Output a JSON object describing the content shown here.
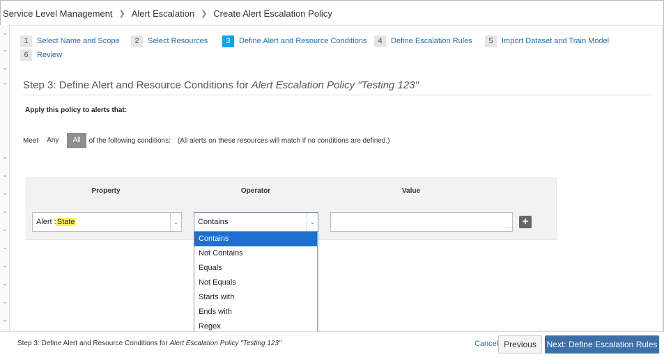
{
  "breadcrumb": [
    "Service Level Management",
    "Alert Escalation",
    "Create Alert Escalation Policy"
  ],
  "wizard": {
    "steps": [
      {
        "num": "1",
        "label": "Select Name and Scope"
      },
      {
        "num": "2",
        "label": "Select Resources"
      },
      {
        "num": "3",
        "label": "Define Alert and Resource Conditions"
      },
      {
        "num": "4",
        "label": "Define Escalation Rules"
      },
      {
        "num": "5",
        "label": "Import Dataset and Train Model"
      },
      {
        "num": "6",
        "label": "Review"
      }
    ],
    "active_step": 3
  },
  "main": {
    "title_prefix": "Step 3: Define Alert and Resource Conditions for ",
    "title_policy": "Alert Escalation Policy \"Testing 123\"",
    "apply_label": "Apply this policy to alerts that:",
    "meet_label": "Meet",
    "match_any": "Any",
    "match_all": "All",
    "selected_match": "All",
    "of_following": "of the following conditions:",
    "note": "(All alerts on these resources will match if no conditions are defined.)"
  },
  "conditions": {
    "headers": {
      "property": "Property",
      "operator": "Operator",
      "value": "Value"
    },
    "property_prefix": "Alert : ",
    "property_value": "State",
    "operator_value": "Contains",
    "value_text": ""
  },
  "operator_dropdown": {
    "options": [
      "Contains",
      "Not Contains",
      "Equals",
      "Not Equals",
      "Starts with",
      "Ends with",
      "Regex"
    ],
    "selected": "Contains"
  },
  "footer": {
    "status_prefix": "Step 3: Define Alert and Resource Conditions for ",
    "status_policy": "Alert Escalation Policy \"Testing 123\"",
    "cancel": "Cancel",
    "previous": "Previous",
    "next": "Next: Define Escalation Rules"
  },
  "icons": {
    "add": "plus-icon",
    "dropdown": "chevron-down-icon",
    "breadcrumb_separator": "chevron-right-icon",
    "resize": "resize-handle-icon"
  },
  "colors": {
    "link": "#1f6fb5",
    "active_step": "#0ea5e9",
    "selected_option": "#1e6fd0",
    "primary_button": "#3d6fa8",
    "highlight": "#fff15a",
    "segment_selected": "#8e8e8e"
  }
}
